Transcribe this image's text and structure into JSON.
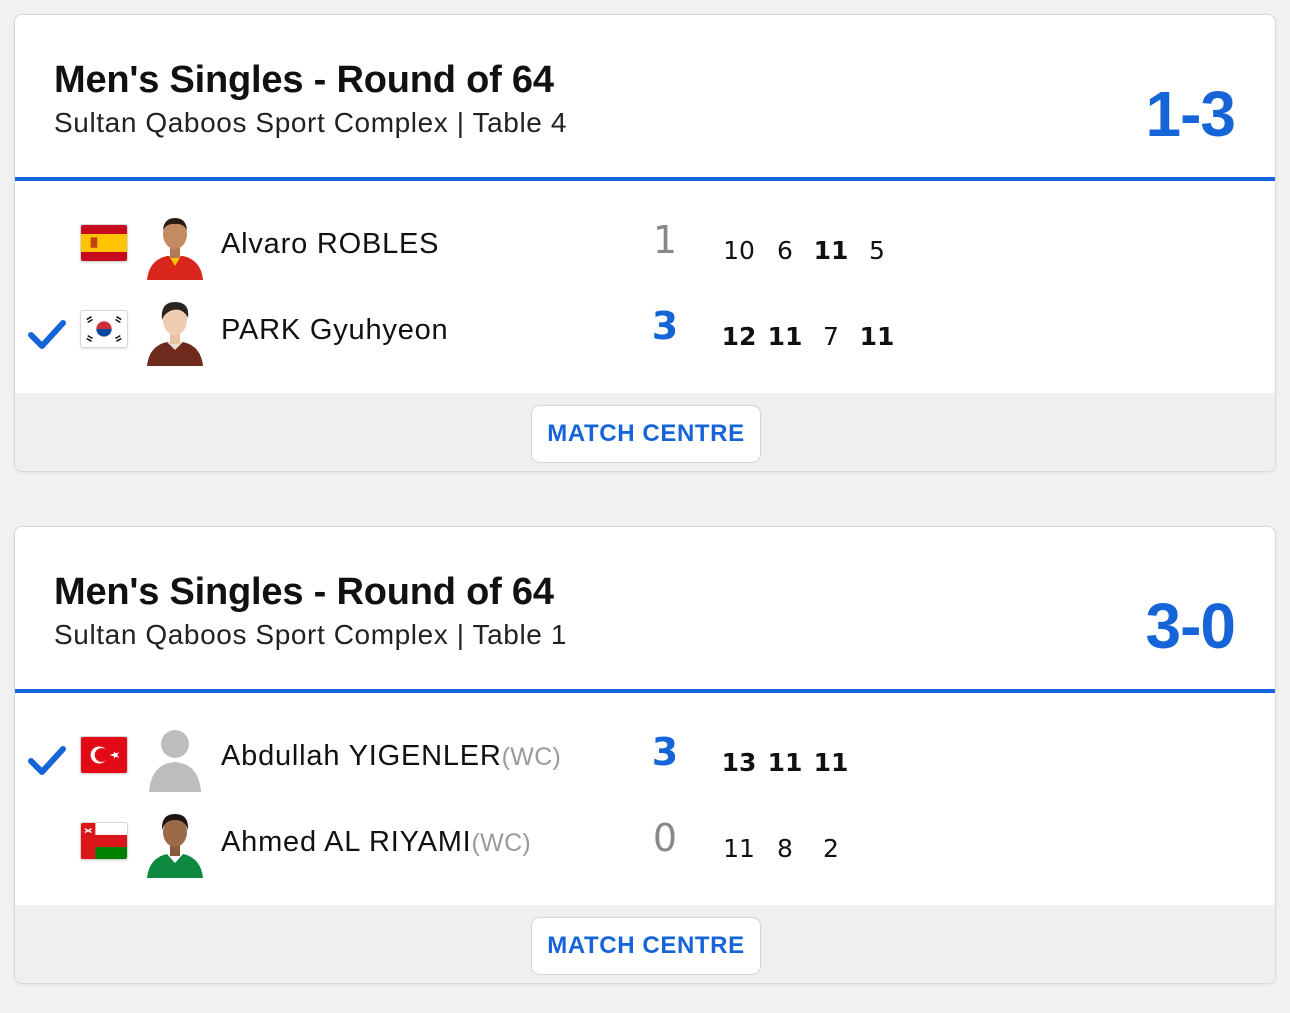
{
  "colors": {
    "accent": "#1565d8",
    "muted": "#888888"
  },
  "matches": [
    {
      "title": "Men's Singles - Round of 64",
      "subtitle": "Sultan Qaboos Sport Complex | Table 4",
      "score": "1-3",
      "players": [
        {
          "name": "Alvaro ROBLES",
          "tag": "",
          "flag": "spain-flag",
          "games": "1",
          "winner": false,
          "points": [
            "10",
            "6",
            "11",
            "5"
          ],
          "bold": [
            false,
            false,
            true,
            false
          ]
        },
        {
          "name": "PARK Gyuhyeon",
          "tag": "",
          "flag": "south-korea-flag",
          "games": "3",
          "winner": true,
          "points": [
            "12",
            "11",
            "7",
            "11"
          ],
          "bold": [
            true,
            true,
            false,
            true
          ]
        }
      ],
      "button": "MATCH CENTRE"
    },
    {
      "title": "Men's Singles - Round of 64",
      "subtitle": "Sultan Qaboos Sport Complex | Table 1",
      "score": "3-0",
      "players": [
        {
          "name": "Abdullah YIGENLER",
          "tag": "(WC)",
          "flag": "turkey-flag",
          "games": "3",
          "winner": true,
          "points": [
            "13",
            "11",
            "11"
          ],
          "bold": [
            true,
            true,
            true
          ]
        },
        {
          "name": "Ahmed AL RIYAMI",
          "tag": "(WC)",
          "flag": "oman-flag",
          "games": "0",
          "winner": false,
          "points": [
            "11",
            "8",
            "2"
          ],
          "bold": [
            false,
            false,
            false
          ]
        }
      ],
      "button": "MATCH CENTRE"
    }
  ]
}
